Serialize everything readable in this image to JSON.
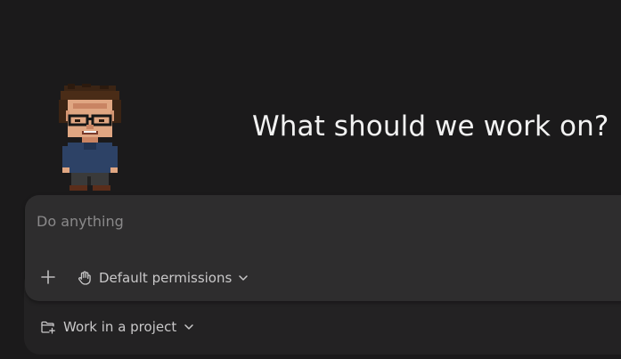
{
  "hero": {
    "headline": "What should we work on?",
    "mascot_icon": "pixel-avatar-man-with-glasses"
  },
  "composer": {
    "placeholder": "Do anything",
    "value": "",
    "add_icon": "plus-icon",
    "permissions": {
      "label": "Default permissions",
      "icon": "hand-icon",
      "chevron": "chevron-down-icon"
    }
  },
  "project": {
    "label": "Work in a project",
    "icon": "folder-plus-icon",
    "chevron": "chevron-down-icon"
  },
  "colors": {
    "background": "#1b1a1b",
    "composer": "#2e2d2e",
    "under_card": "#232223",
    "text": "#f2f2f2",
    "muted": "#8a898a"
  }
}
